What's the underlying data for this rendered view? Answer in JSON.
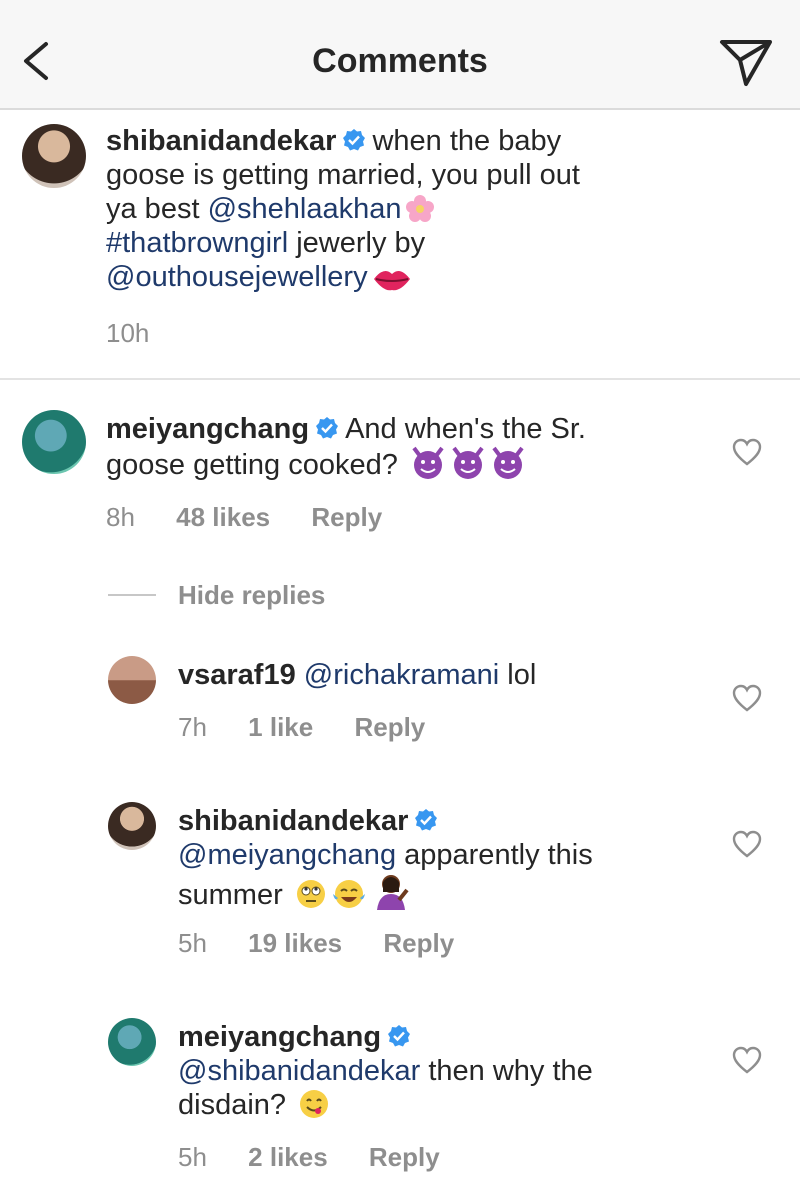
{
  "header": {
    "title": "Comments"
  },
  "caption": {
    "username": "shibanidandekar",
    "text_1": "when the baby",
    "text_2": "goose is getting married, you pull out",
    "text_3": "ya best",
    "mention_1": "@shehlaakhan",
    "hashtag": "#thatbrowngirl",
    "text_4": "jewerly by",
    "mention_2": "@outhousejewellery",
    "time": "10h"
  },
  "comment": {
    "username": "meiyangchang",
    "text_1": "And when's the Sr.",
    "text_2": "goose getting cooked?",
    "time": "8h",
    "likes": "48 likes",
    "reply": "Reply"
  },
  "hide_replies": "Hide replies",
  "replies": [
    {
      "username": "vsaraf19",
      "mention": "@richakramani",
      "text": "lol",
      "time": "7h",
      "likes": "1 like",
      "reply": "Reply"
    },
    {
      "username": "shibanidandekar",
      "mention": "@meiyangchang",
      "text_1": "apparently this",
      "text_2": "summer",
      "time": "5h",
      "likes": "19 likes",
      "reply": "Reply"
    },
    {
      "username": "meiyangchang",
      "mention": "@shibanidandekar",
      "text_1": "then why the",
      "text_2": "disdain?",
      "time": "5h",
      "likes": "2 likes",
      "reply": "Reply"
    }
  ],
  "colors": {
    "mention": "#1f3a6b",
    "verified": "#3897f0",
    "meta": "#8e8e8e"
  }
}
